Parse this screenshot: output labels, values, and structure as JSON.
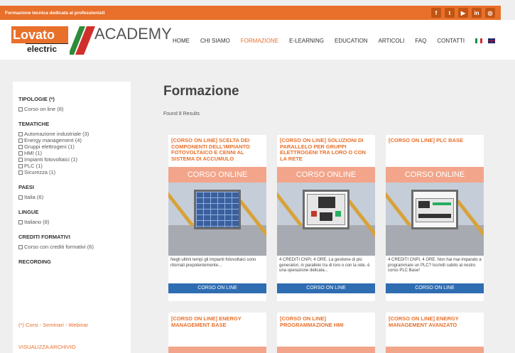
{
  "topbar": {
    "text": "Formazione tecnica dedicata ai professionisti",
    "socials": [
      "f",
      "t",
      "▶",
      "in",
      "◎"
    ]
  },
  "logo": {
    "brand": "Lovato",
    "sub": "electric",
    "academy": "ACADEMY"
  },
  "nav": {
    "items": [
      "HOME",
      "CHI SIAMO",
      "FORMAZIONE",
      "E-LEARNING",
      "EDUCATION",
      "ARTICOLI",
      "FAQ",
      "CONTATTI"
    ],
    "active_index": 2
  },
  "sidebar": {
    "tipologie": {
      "heading": "TIPOLOGIE (*)",
      "items": [
        "Corso on line (8)"
      ]
    },
    "tematiche": {
      "heading": "TEMATICHE",
      "items": [
        "Automazione industriale (3)",
        "Energy management (4)",
        "Gruppi elettrogeni (1)",
        "HMI (1)",
        "Impianti fotovoltaici (1)",
        "PLC (1)",
        "Sicurezza (1)"
      ]
    },
    "paesi": {
      "heading": "PAESI",
      "items": [
        "Italia (6)"
      ]
    },
    "lingue": {
      "heading": "LINGUE",
      "items": [
        "Italiano (8)"
      ]
    },
    "crediti": {
      "heading": "CREDITI FORMATIVI",
      "items": [
        "Corso con crediti formativi (6)"
      ]
    },
    "recording": {
      "heading": "RECORDING"
    },
    "footnote": "(*) Corsi - Seminari - Webinar",
    "archive_link": "VISUALIZZA ARCHIVIO"
  },
  "main": {
    "title": "Formazione",
    "results": "Found 8 Results",
    "cards": [
      {
        "title": "[CORSO ON LINE] SCELTA DEI COMPONENTI DELL'IMPIANTO FOTOVOLTAICO E CENNI AL SISTEMA DI ACCUMULO",
        "banner": "CORSO ONLINE",
        "desc": "Negli ultimi tempi gli impianti fotovoltaici sono ritornati prepotentemente...",
        "button": "CORSO ON LINE"
      },
      {
        "title": "[CORSO ON LINE] SOLUZIONI DI PARALLELO PER GRUPPI ELETTROGENI TRA LORO O CON LA RETE",
        "banner": "CORSO ONLINE",
        "desc": "4 CREDITI CNPI, 4 ORE. La gestione di più generatori, in parallelo tra di loro o con la rete, è una operazione delicata...",
        "button": "CORSO ON LINE"
      },
      {
        "title": "[CORSO ON LINE] PLC BASE",
        "banner": "CORSO ONLINE",
        "desc": "4 CREDITI CNPI, 4 ORE. Non hai mai imparato a programmare un PLC? Iscriviti subito al nostro corso PLC Base!",
        "button": "CORSO ON LINE"
      }
    ],
    "cards2": [
      {
        "title": "[CORSO ON LINE] ENERGY MANAGEMENT BASE"
      },
      {
        "title": "[CORSO ON LINE] PROGRAMMAZIONE HMI"
      },
      {
        "title": "[CORSO ON LINE] ENERGY MANAGEMENT AVANZATO"
      }
    ]
  },
  "colors": {
    "accent": "#e8702a",
    "button": "#2f6db2",
    "banner": "#f2a58a"
  }
}
